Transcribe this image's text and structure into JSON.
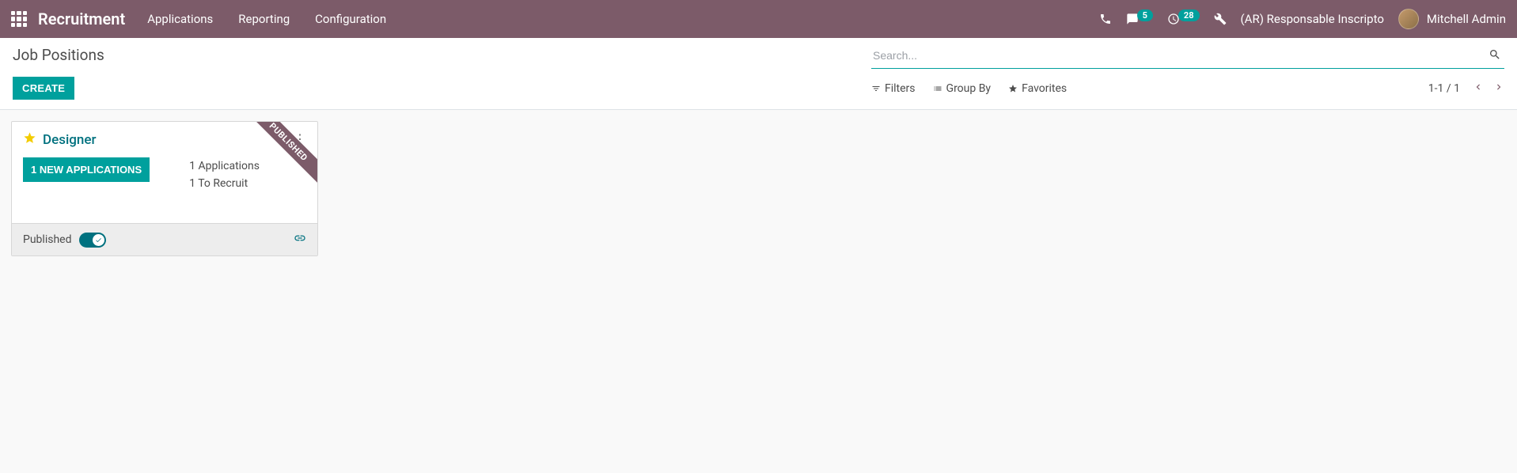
{
  "navbar": {
    "brand": "Recruitment",
    "menu": [
      "Applications",
      "Reporting",
      "Configuration"
    ],
    "messages_badge": "5",
    "activities_badge": "28",
    "company": "(AR) Responsable Inscripto",
    "user": "Mitchell Admin"
  },
  "breadcrumb": "Job Positions",
  "search": {
    "placeholder": "Search..."
  },
  "buttons": {
    "create": "CREATE"
  },
  "toolbar": {
    "filters": "Filters",
    "groupby": "Group By",
    "favorites": "Favorites"
  },
  "pager": {
    "text": "1-1 / 1"
  },
  "card": {
    "title": "Designer",
    "ribbon": "PUBLISHED",
    "new_apps_btn": "1 NEW APPLICATIONS",
    "applications_line": "1 Applications",
    "recruit_line": "1 To Recruit",
    "footer_label": "Published"
  }
}
